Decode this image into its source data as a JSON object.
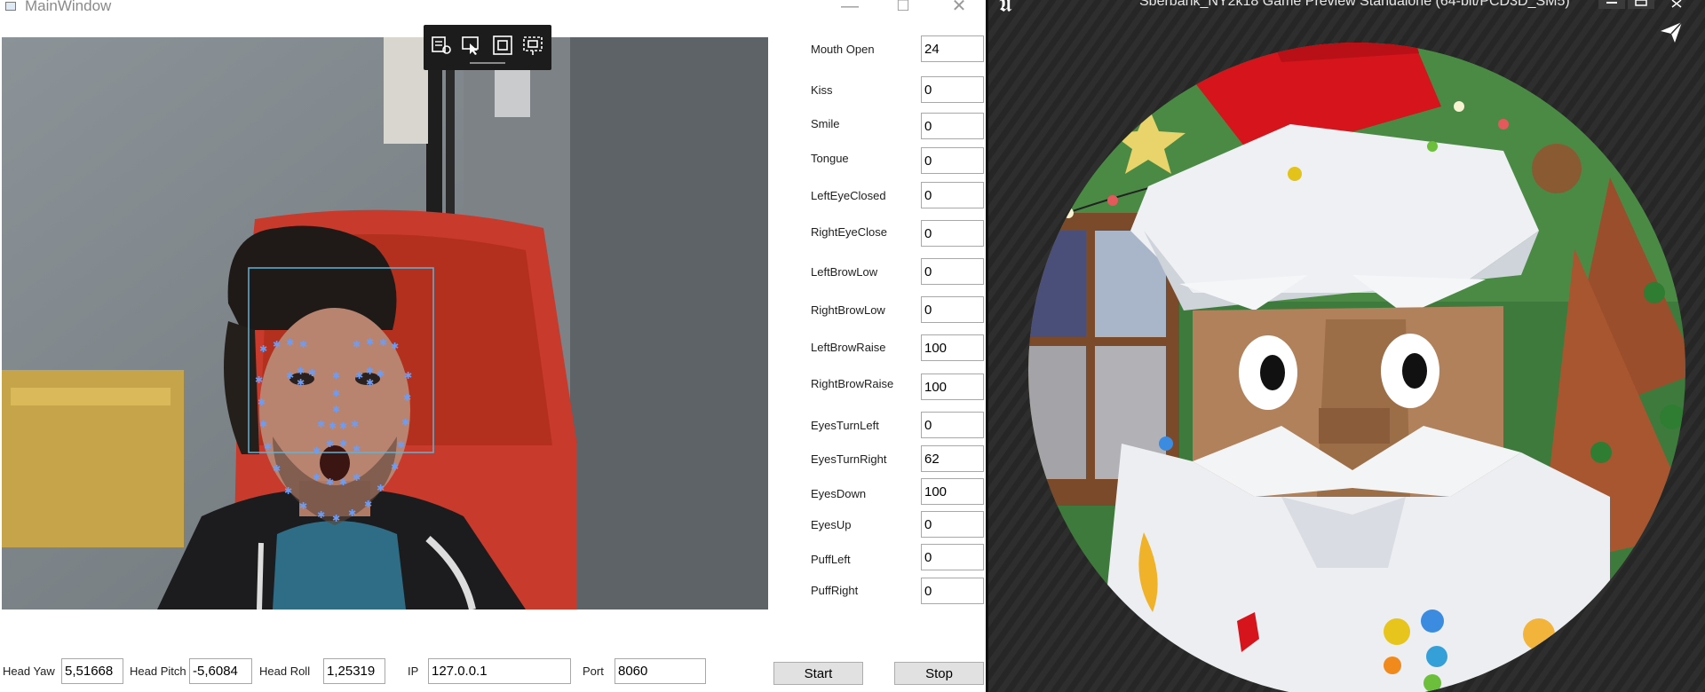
{
  "main_window": {
    "title": "MainWindow",
    "caption_buttons": {
      "minimize": "—",
      "maximize": "☐",
      "close": "✕"
    }
  },
  "camera_toolbar": {
    "icons": [
      "inspect-tree-icon",
      "select-element-icon",
      "display-layout-adorners-icon",
      "track-focused-element-icon"
    ]
  },
  "expressions": [
    {
      "label": "Mouth Open",
      "value": "24"
    },
    {
      "label": "Kiss",
      "value": "0"
    },
    {
      "label": "Smile",
      "value": "0"
    },
    {
      "label": "Tongue",
      "value": "0"
    },
    {
      "label": "LeftEyeClosed",
      "value": "0"
    },
    {
      "label": "RightEyeClose",
      "value": "0"
    },
    {
      "label": "LeftBrowLow",
      "value": "0"
    },
    {
      "label": "RightBrowLow",
      "value": "0"
    },
    {
      "label": "LeftBrowRaise",
      "value": "100"
    },
    {
      "label": "RightBrowRaise",
      "value": "100"
    },
    {
      "label": "EyesTurnLeft",
      "value": "0"
    },
    {
      "label": "EyesTurnRight",
      "value": "62"
    },
    {
      "label": "EyesDown",
      "value": "100"
    },
    {
      "label": "EyesUp",
      "value": "0"
    },
    {
      "label": "PuffLeft",
      "value": "0"
    },
    {
      "label": "PuffRight",
      "value": "0"
    }
  ],
  "bottom_bar": {
    "head_yaw": {
      "label": "Head Yaw",
      "value": "5,51668"
    },
    "head_pitch": {
      "label": "Head Pitch",
      "value": "-5,6084"
    },
    "head_roll": {
      "label": "Head Roll",
      "value": "1,25319"
    },
    "ip": {
      "label": "IP",
      "value": "127.0.0.1"
    },
    "port": {
      "label": "Port",
      "value": "8060"
    },
    "start_label": "Start",
    "stop_label": "Stop"
  },
  "game_window": {
    "title": "Sberbank_NY2k18 Game Preview Standalone (64-bit/PCD3D_SM5)",
    "logo_glyph": "𝖀"
  },
  "colors": {
    "landmark": "#6f9cf0",
    "face_box": "#5fb3d8",
    "hat_red": "#d5141b",
    "background_green": "#3f7a3d"
  }
}
